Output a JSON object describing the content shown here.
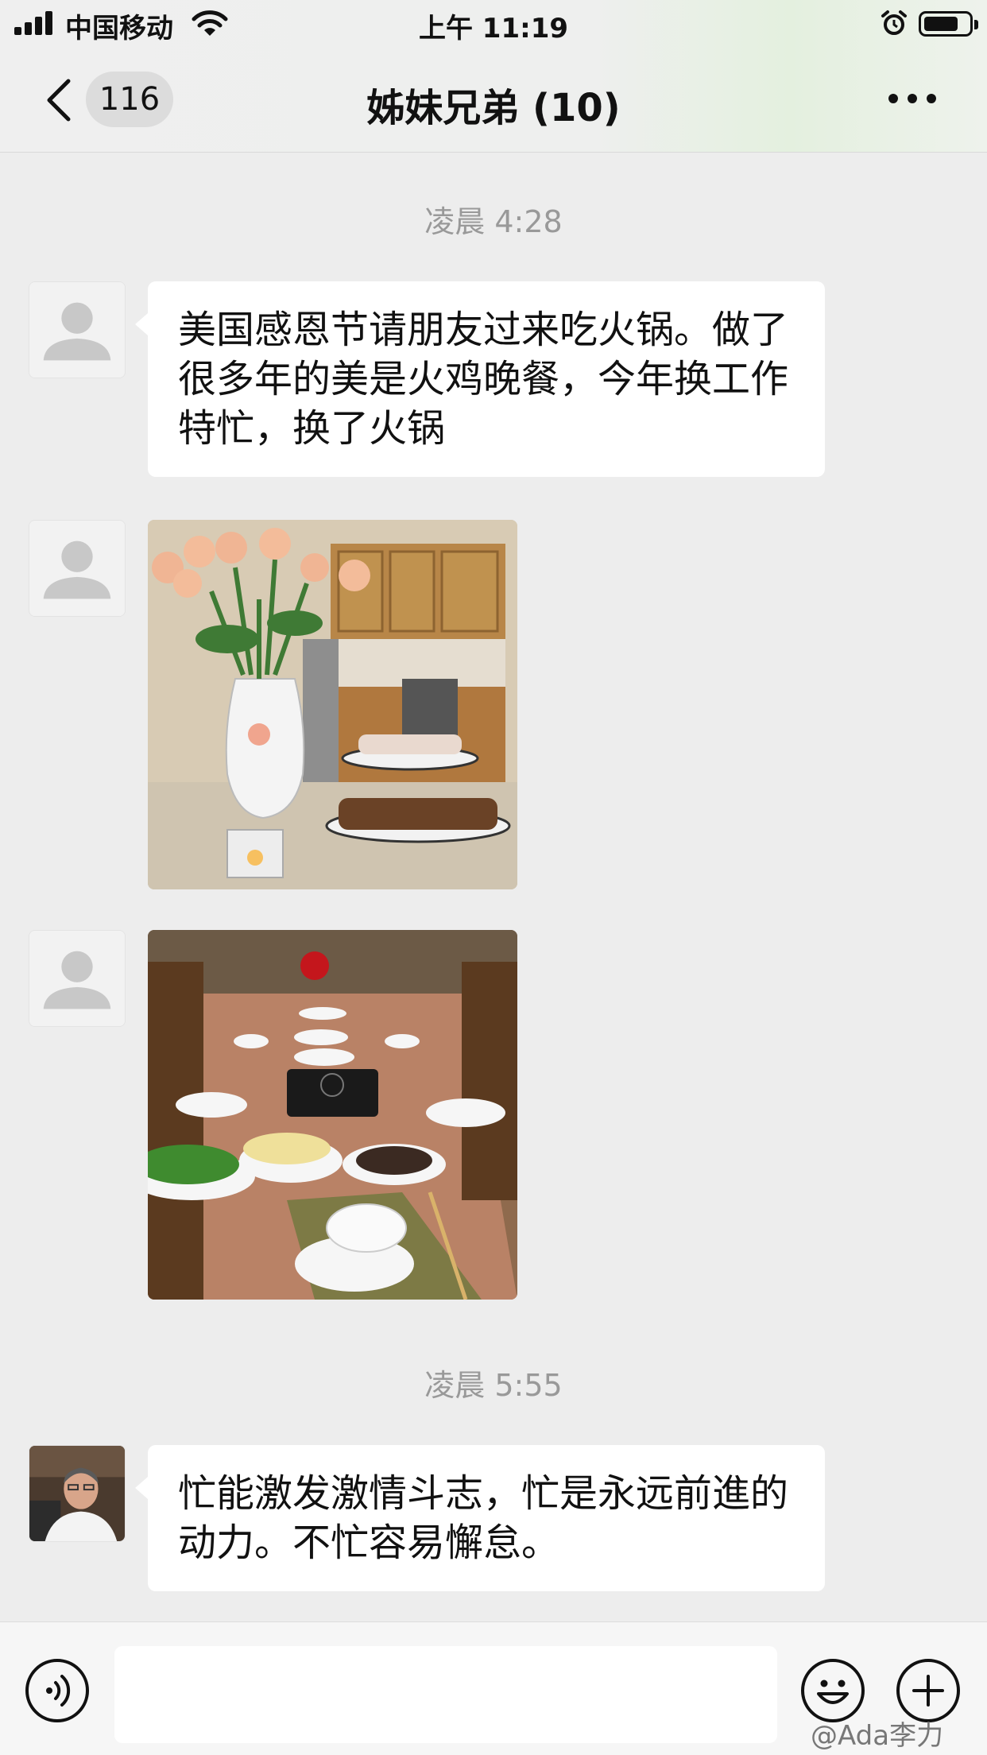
{
  "status_bar": {
    "carrier": "中国移动",
    "time": "上午 11:19",
    "icons": [
      "signal-icon",
      "wifi-icon",
      "alarm-icon",
      "battery-icon"
    ]
  },
  "nav": {
    "unread_count": "116",
    "title": "姊妹兄弟 (10)",
    "icons": [
      "back-chevron-icon",
      "more-dots-icon"
    ]
  },
  "messages": {
    "timestamp_1": "凌晨 4:28",
    "text_1": "美国感恩节请朋友过来吃火锅。做了很多年的美是火鸡晚餐，今年换工作特忙，换了火锅",
    "timestamp_2": "凌晨 5:55",
    "text_2": "忙能激发激情斗志，忙是永远前進的动力。不忙容易懈怠。"
  },
  "input_bar": {
    "icons": [
      "voice-icon",
      "emoji-icon",
      "plus-icon"
    ]
  },
  "watermark": "@Ada李力",
  "colors": {
    "background": "#ededed",
    "bubble": "#ffffff",
    "timestamp": "#999999"
  }
}
